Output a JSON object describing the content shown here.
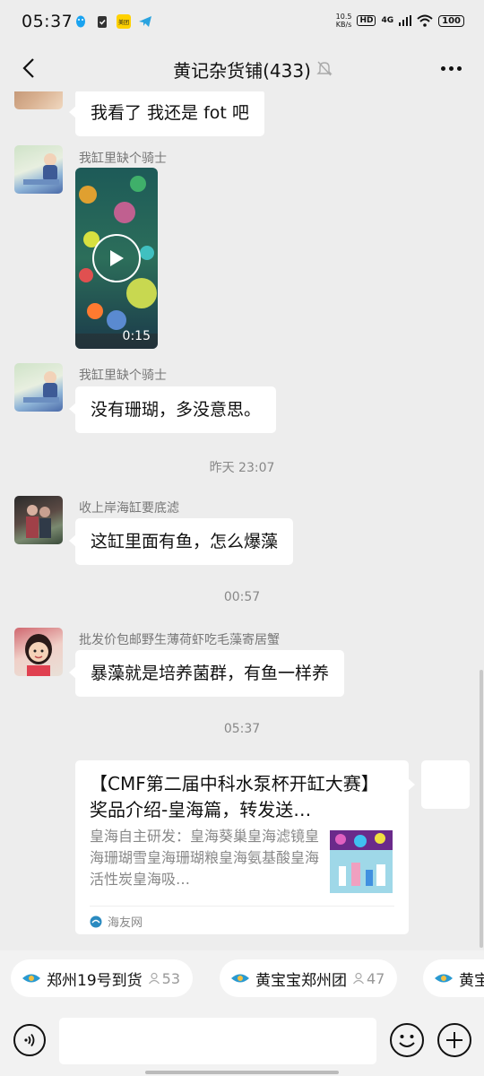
{
  "status_bar": {
    "time": "05:37",
    "speed_value": "10.5",
    "speed_unit": "KB/s",
    "hd_label": "HD",
    "network_label": "4G",
    "battery": "100",
    "app_icon_text": "美团"
  },
  "header": {
    "title": "黄记杂货铺(433)"
  },
  "messages": [
    {
      "type": "text",
      "sender": "",
      "text": "我看了 我还是 fot 吧"
    },
    {
      "type": "video",
      "sender": "我缸里缺个骑士",
      "duration": "0:15"
    },
    {
      "type": "text",
      "sender": "我缸里缺个骑士",
      "text": "没有珊瑚，多没意思。"
    },
    {
      "type": "time",
      "text": "昨天 23:07"
    },
    {
      "type": "text",
      "sender": "收上岸海缸要底滤",
      "text": "这缸里面有鱼，怎么爆藻"
    },
    {
      "type": "time",
      "text": "00:57"
    },
    {
      "type": "text",
      "sender": "批发价包邮野生薄荷虾吃毛藻寄居蟹",
      "text": "暴藻就是培养菌群，有鱼一样养"
    },
    {
      "type": "time",
      "text": "05:37"
    }
  ],
  "link_card": {
    "title": "【CMF第二届中科水泵杯开缸大赛】奖品介绍-皇海篇，转发送…",
    "description": "皇海自主研发：皇海葵巢皇海滤镜皇海珊瑚雪皇海珊瑚粮皇海氨基酸皇海活性炭皇海吸…",
    "source": "海友网"
  },
  "quick_chips": [
    {
      "label": "郑州19号到货",
      "count": "53"
    },
    {
      "label": "黄宝宝郑州团",
      "count": "47"
    },
    {
      "label": "黄宝",
      "count": ""
    }
  ],
  "input": {
    "placeholder": ""
  },
  "colors": {
    "background": "#ededed",
    "bubble": "#ffffff",
    "meta_text": "#888888"
  }
}
